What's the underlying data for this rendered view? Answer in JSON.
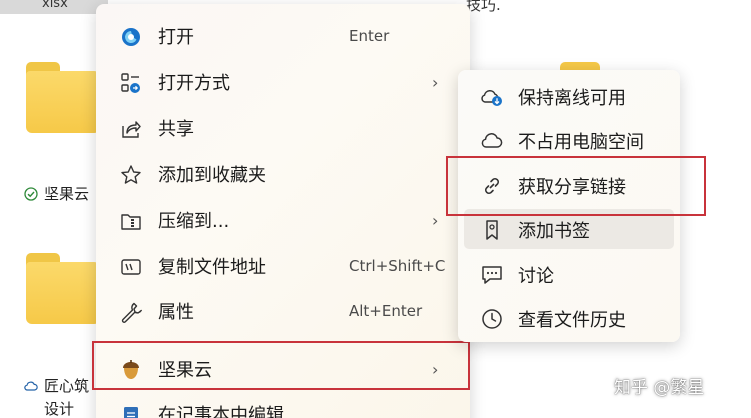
{
  "background": {
    "tab_label": "xlsx",
    "right_text": "技巧.",
    "folders": [
      {
        "label": "坚果云",
        "status_icon": "check-circle-icon"
      },
      {
        "label": "匠心筑",
        "label_line2": "设计",
        "status_icon": "cloud-icon"
      }
    ]
  },
  "context_menu": {
    "items": [
      {
        "icon": "jianguoyun-open-icon",
        "label": "打开",
        "shortcut": "Enter"
      },
      {
        "icon": "open-with-icon",
        "label": "打开方式",
        "has_submenu": true
      },
      {
        "icon": "share-icon",
        "label": "共享"
      },
      {
        "icon": "star-icon",
        "label": "添加到收藏夹"
      },
      {
        "icon": "zip-folder-icon",
        "label": "压缩到...",
        "has_submenu": true
      },
      {
        "icon": "copy-path-icon",
        "label": "复制文件地址",
        "shortcut": "Ctrl+Shift+C"
      },
      {
        "icon": "wrench-icon",
        "label": "属性",
        "shortcut": "Alt+Enter"
      },
      {
        "icon": "acorn-icon",
        "label": "坚果云",
        "has_submenu": true,
        "highlighted": true
      },
      {
        "icon": "notepad-icon",
        "label": "在记事本中编辑"
      }
    ],
    "submenu_arrow": "›"
  },
  "sub_menu": {
    "items": [
      {
        "icon": "cloud-offline-icon",
        "label": "保持离线可用"
      },
      {
        "icon": "cloud-outline-icon",
        "label": "不占用电脑空间"
      },
      {
        "icon": "link-icon",
        "label": "获取分享链接",
        "highlighted": true
      },
      {
        "icon": "bookmark-icon",
        "label": "添加书签",
        "hover": true
      },
      {
        "icon": "chat-icon",
        "label": "讨论"
      },
      {
        "icon": "history-icon",
        "label": "查看文件历史"
      }
    ]
  },
  "watermark": "知乎 @繁星",
  "colors": {
    "annotation_red": "#c8333b",
    "folder_yellow": "#f6c948",
    "menu_bg": "#fcf9f3",
    "hover_bg": "#ece9e4"
  }
}
